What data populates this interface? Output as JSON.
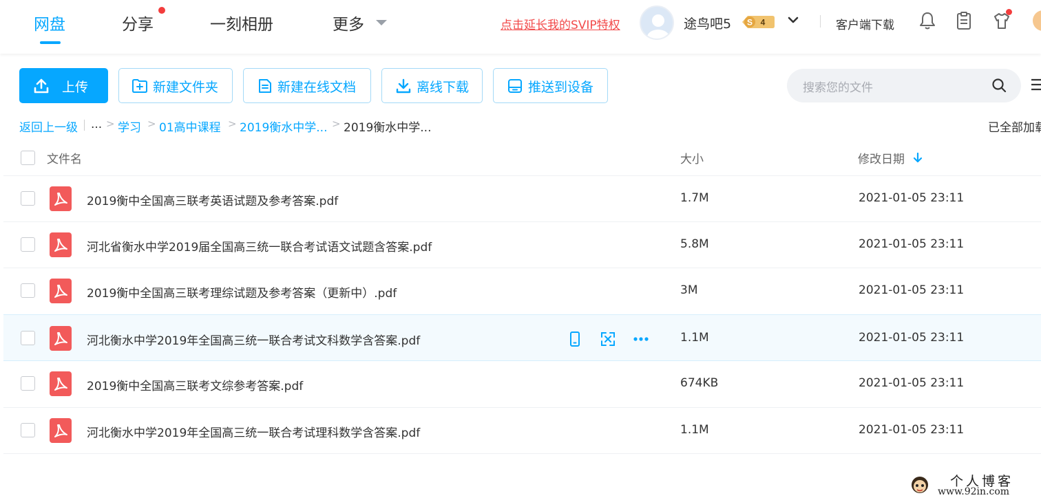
{
  "nav": {
    "tabs": [
      {
        "label": "网盘",
        "active": true
      },
      {
        "label": "分享",
        "has_dot": true
      },
      {
        "label": "一刻相册"
      },
      {
        "label": "更多"
      }
    ]
  },
  "header": {
    "svip_link": "点击延长我的SVIP特权",
    "username": "途鸟吧5",
    "level_badge": {
      "s": "S",
      "level": "4"
    },
    "client_download": "客户端下载",
    "icons": [
      "bell-icon",
      "clipboard-icon",
      "shirt-icon"
    ]
  },
  "toolbar": {
    "upload": "上传",
    "new_folder": "新建文件夹",
    "new_doc": "新建在线文档",
    "offline_download": "离线下载",
    "push_device": "推送到设备",
    "search_placeholder": "搜索您的文件"
  },
  "breadcrumb": {
    "back": "返回上一级",
    "ellipsis": "...",
    "items": [
      "学习",
      "01高中课程",
      "2019衡水中学..."
    ],
    "current": "2019衡水中学...",
    "status": "已全部加载"
  },
  "columns": {
    "name": "文件名",
    "size": "大小",
    "date": "修改日期"
  },
  "files": [
    {
      "name": "2019衡中全国高三联考英语试题及参考答案.pdf",
      "size": "1.7M",
      "date": "2021-01-05 23:11"
    },
    {
      "name": "河北省衡水中学2019届全国高三统一联合考试语文试题含答案.pdf",
      "size": "5.8M",
      "date": "2021-01-05 23:11"
    },
    {
      "name": "2019衡中全国高三联考理综试题及参考答案（更新中）.pdf",
      "size": "3M",
      "date": "2021-01-05 23:11"
    },
    {
      "name": "河北衡水中学2019年全国高三统一联合考试文科数学含答案.pdf",
      "size": "1.1M",
      "date": "2021-01-05 23:11",
      "hovered": true
    },
    {
      "name": "2019衡中全国高三联考文综参考答案.pdf",
      "size": "674KB",
      "date": "2021-01-05 23:11"
    },
    {
      "name": "河北衡水中学2019年全国高三统一联合考试理科数学含答案.pdf",
      "size": "1.1M",
      "date": "2021-01-05 23:11"
    }
  ],
  "row_actions": [
    "phone-icon",
    "share-icon",
    "more-icon"
  ],
  "watermark": {
    "title": "个人博客",
    "url": "www.92in.com"
  },
  "colors": {
    "accent": "#06a7ff",
    "pdf_red": "#f25a5a",
    "svip_red": "#f24a4a"
  }
}
